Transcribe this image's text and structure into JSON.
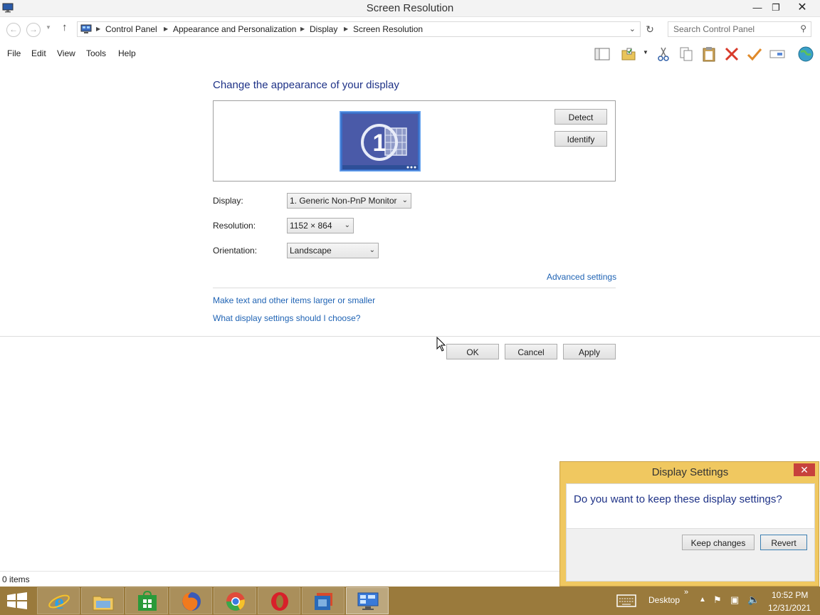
{
  "window": {
    "title": "Screen Resolution",
    "controls": [
      "minimize-icon",
      "restore-icon",
      "close-icon"
    ]
  },
  "address": {
    "breadcrumbs": [
      "Control Panel",
      "Appearance and Personalization",
      "Display",
      "Screen Resolution"
    ],
    "search_placeholder": "Search Control Panel"
  },
  "menu": {
    "items": [
      "File",
      "Edit",
      "View",
      "Tools",
      "Help"
    ]
  },
  "toolbar": {
    "icons": [
      "preview-pane-icon",
      "properties-icon",
      "cut-icon",
      "copy-icon",
      "paste-icon",
      "delete-icon",
      "checkmark-icon",
      "rename-icon",
      "globe-icon"
    ]
  },
  "main": {
    "heading": "Change the appearance of your display",
    "monitor_number": "1",
    "detect": "Detect",
    "identify": "Identify",
    "display_label": "Display:",
    "display_value": "1. Generic Non-PnP Monitor",
    "resolution_label": "Resolution:",
    "resolution_value": "1152 × 864",
    "orientation_label": "Orientation:",
    "orientation_value": "Landscape",
    "advanced": "Advanced settings",
    "link_text_size": "Make text and other items larger or smaller",
    "link_help": "What display settings should I choose?",
    "ok": "OK",
    "cancel": "Cancel",
    "apply": "Apply"
  },
  "status": {
    "items": "0 items"
  },
  "dialog": {
    "title": "Display Settings",
    "message": "Do you want to keep these display settings?",
    "keep": "Keep changes",
    "revert": "Revert"
  },
  "taskbar": {
    "apps": [
      "internet-explorer-icon",
      "file-explorer-icon",
      "store-icon",
      "firefox-icon",
      "chrome-icon",
      "opera-icon",
      "file-manager-icon",
      "control-panel-icon"
    ],
    "desktop_label": "Desktop",
    "chevron": "»",
    "time": "10:52 PM",
    "date": "12/31/2021"
  },
  "colors": {
    "heading": "#1e3287",
    "link": "#1f63b4",
    "dialog_frame": "#f0c860",
    "taskbar": "#9a7a3c",
    "close": "#c7413c"
  }
}
